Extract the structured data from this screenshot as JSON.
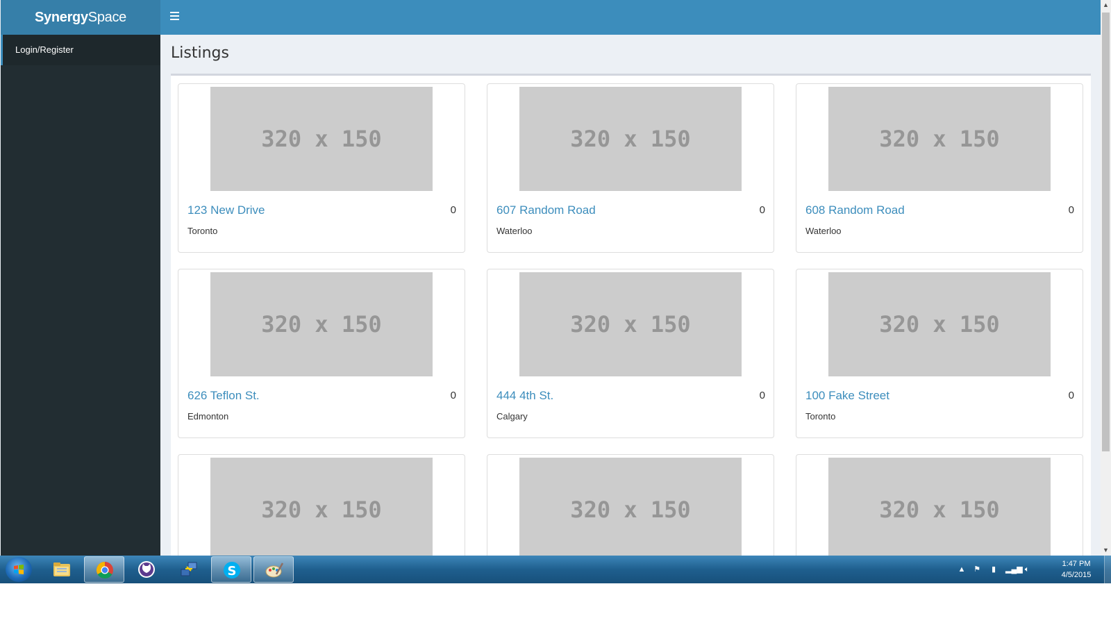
{
  "app": {
    "brand_bold": "Synergy",
    "brand_light": "Space"
  },
  "sidebar": {
    "items": [
      {
        "label": "Login/Register"
      }
    ]
  },
  "main": {
    "title": "Listings",
    "listings": [
      {
        "image_text": "320 x 150",
        "title": "123 New Drive",
        "count": "0",
        "city": "Toronto"
      },
      {
        "image_text": "320 x 150",
        "title": "607 Random Road",
        "count": "0",
        "city": "Waterloo"
      },
      {
        "image_text": "320 x 150",
        "title": "608 Random Road",
        "count": "0",
        "city": "Waterloo"
      },
      {
        "image_text": "320 x 150",
        "title": "626 Teflon St.",
        "count": "0",
        "city": "Edmonton"
      },
      {
        "image_text": "320 x 150",
        "title": "444 4th St.",
        "count": "0",
        "city": "Calgary"
      },
      {
        "image_text": "320 x 150",
        "title": "100 Fake Street",
        "count": "0",
        "city": "Toronto"
      },
      {
        "image_text": "320 x 150"
      },
      {
        "image_text": "320 x 150"
      },
      {
        "image_text": "320 x 150"
      }
    ]
  },
  "taskbar": {
    "apps": [
      "windows-explorer",
      "chrome",
      "github",
      "network-tool",
      "skype",
      "paint"
    ],
    "time": "1:47 PM",
    "date": "4/5/2015"
  },
  "colors": {
    "header": "#3c8dbc",
    "logo_bg": "#367fa9",
    "sidebar_bg": "#222d32",
    "link": "#3c8dbc"
  }
}
